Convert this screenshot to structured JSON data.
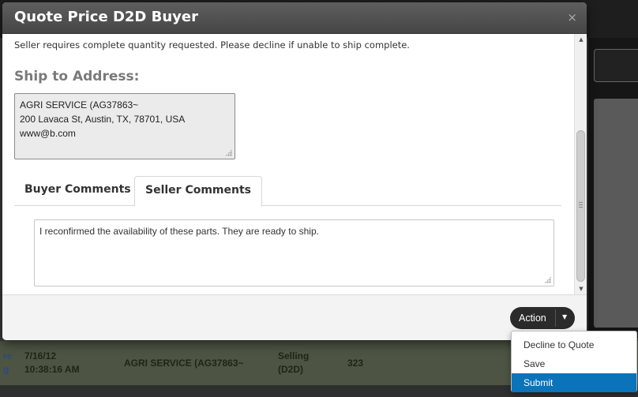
{
  "modal": {
    "title": "Quote Price D2D Buyer",
    "close_glyph": "×",
    "note": "Seller requires complete quantity requested. Please decline if unable to ship complete.",
    "ship_heading": "Ship to Address:",
    "address": {
      "line1": "AGRI SERVICE (AG37863~",
      "line2": "200 Lavaca St, Austin, TX, 78701, USA",
      "line3": "www@b.com"
    },
    "tabs": [
      {
        "label": "Buyer Comments",
        "active": false
      },
      {
        "label": "Seller Comments",
        "active": true
      }
    ],
    "seller_comment": "I reconfirmed the availability of these parts. They are ready to ship."
  },
  "action": {
    "label": "Action",
    "menu": [
      {
        "label": "Decline to Quote",
        "selected": false
      },
      {
        "label": "Save",
        "selected": false
      },
      {
        "label": "Submit",
        "selected": true
      }
    ]
  },
  "background_row": {
    "edge_line1": "re",
    "edge_line2": "g",
    "date": "7/16/12",
    "time": "10:38:16 AM",
    "customer": "AGRI SERVICE (AG37863~",
    "type_line1": "Selling",
    "type_line2": "(D2D)",
    "qty": "323"
  },
  "colors": {
    "header_bg": "#4f4f4f",
    "menu_selected": "#0a73b9",
    "action_button": "#2b2b2b"
  }
}
